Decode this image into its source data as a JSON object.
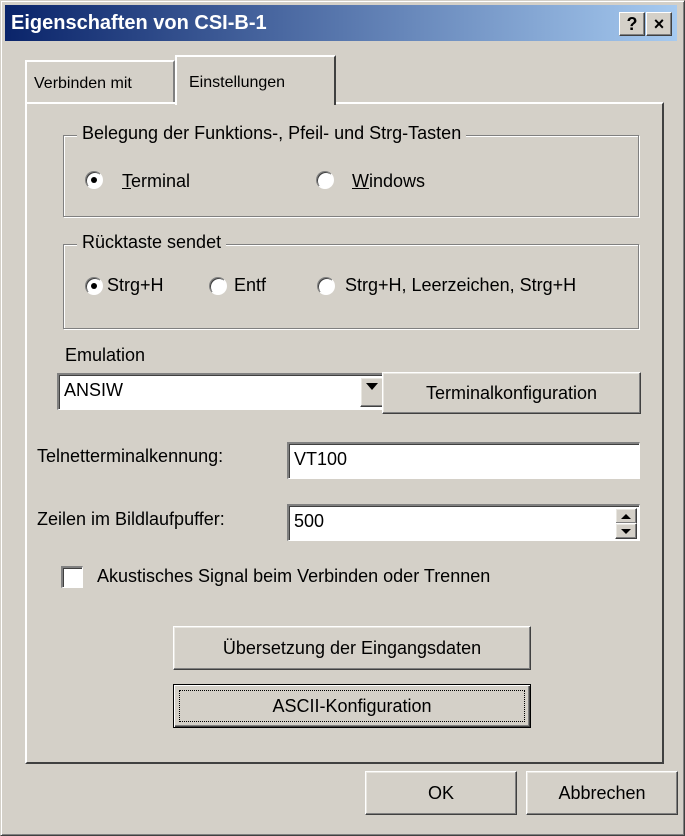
{
  "window": {
    "title": "Eigenschaften von CSI-B-1",
    "help_label": "?",
    "close_label": "×"
  },
  "tabs": [
    {
      "label": "Verbinden mit",
      "active": false
    },
    {
      "label": "Einstellungen",
      "active": true
    }
  ],
  "keys_group": {
    "legend": "Belegung der Funktions-, Pfeil- und Strg-Tasten",
    "options": [
      {
        "label_first": "T",
        "label_rest": "erminal",
        "selected": true
      },
      {
        "label_first": "W",
        "label_rest": "indows",
        "selected": false
      }
    ]
  },
  "backspace_group": {
    "legend": "Rücktaste sendet",
    "options": [
      {
        "label": "Strg+H",
        "selected": true
      },
      {
        "label": "Entf",
        "selected": false
      },
      {
        "label": "Strg+H, Leerzeichen, Strg+H",
        "selected": false
      }
    ]
  },
  "emulation": {
    "label": "Emulation",
    "value": "ANSIW",
    "config_button": "Terminalkonfiguration"
  },
  "telnet": {
    "label": "Telnetterminalkennung:",
    "value": "VT100"
  },
  "scrollback": {
    "label": "Zeilen im Bildlaufpuffer:",
    "value": "500"
  },
  "acoustic_signal": {
    "label": "Akustisches Signal beim Verbinden oder Trennen",
    "checked": false
  },
  "buttons": {
    "translation": "Übersetzung der Eingangsdaten",
    "ascii": "ASCII-Konfiguration",
    "ok": "OK",
    "cancel": "Abbrechen"
  },
  "colors": {
    "titlebar_start": "#0a246a",
    "titlebar_end": "#a6caf0",
    "face": "#d4d0c8"
  }
}
